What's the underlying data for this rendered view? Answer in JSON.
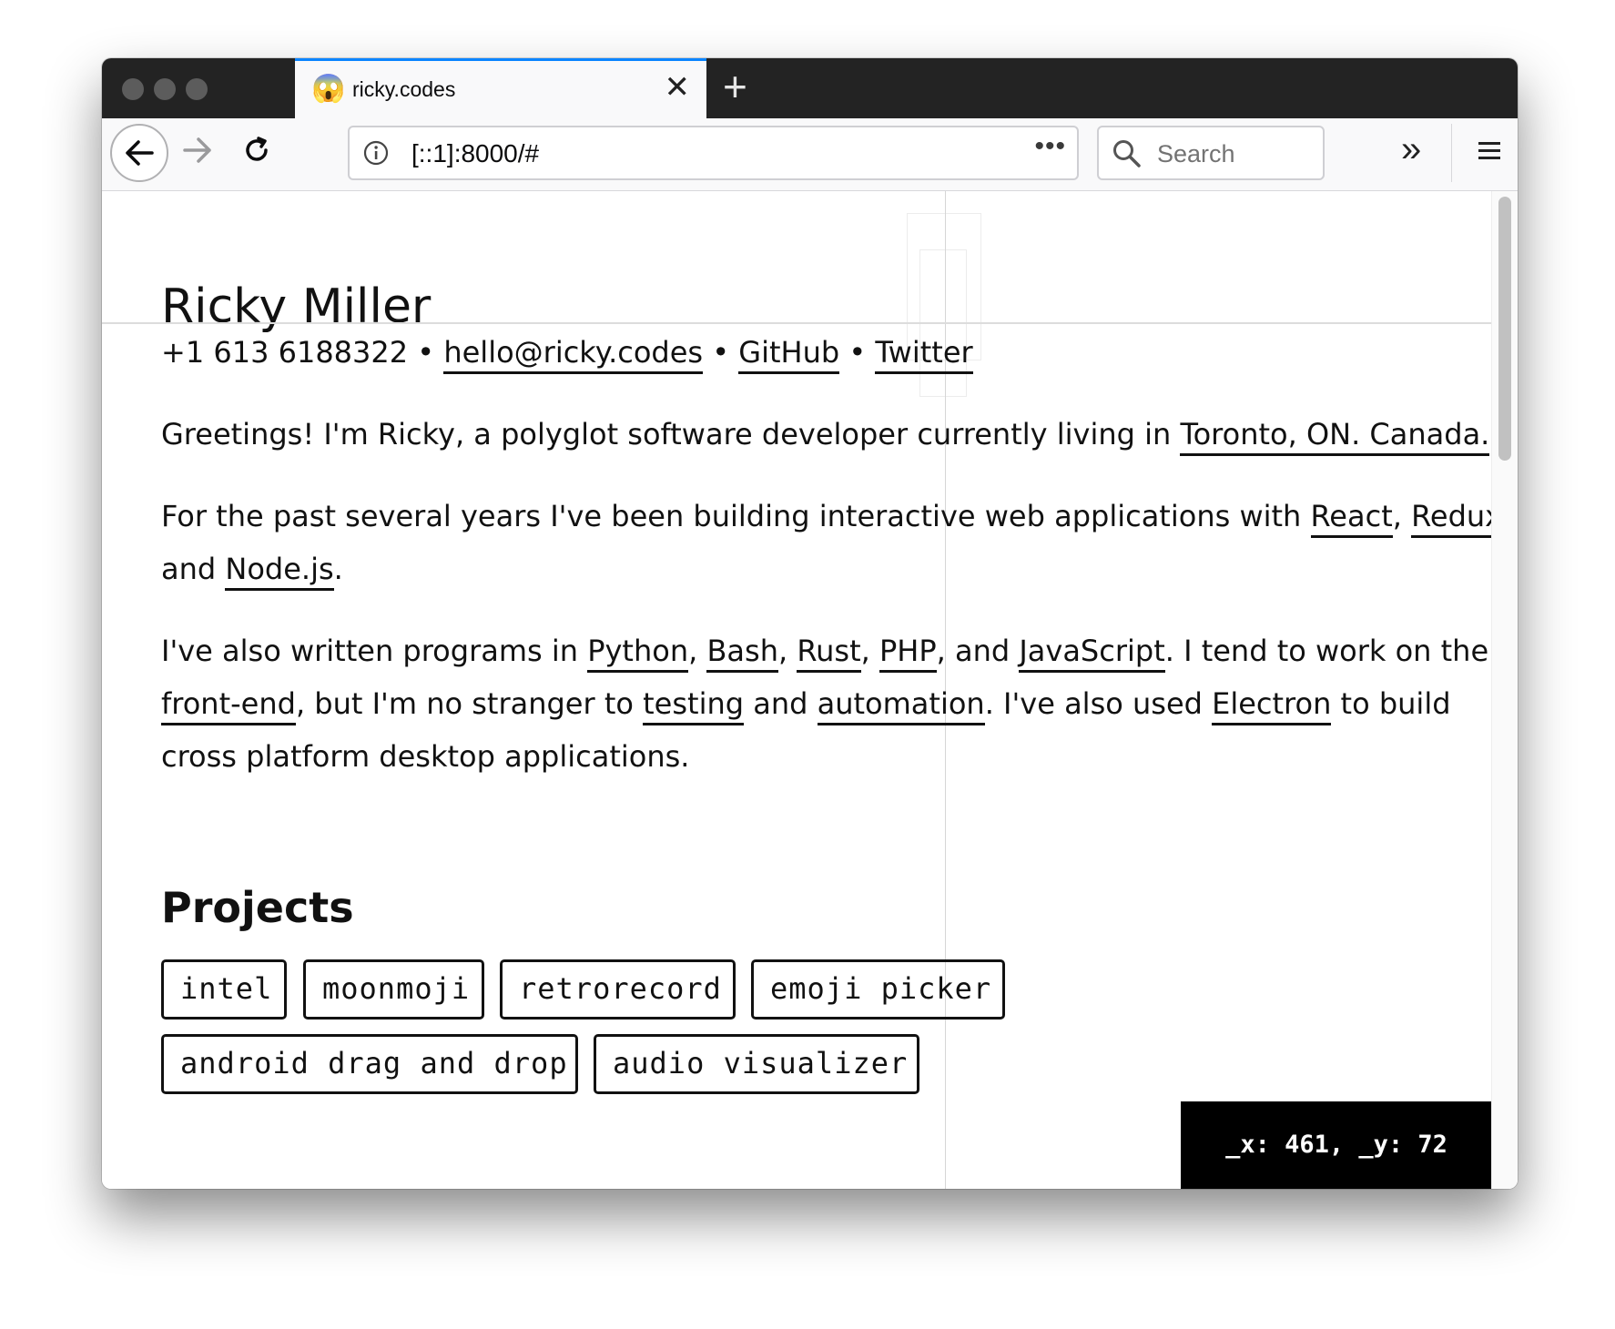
{
  "browser": {
    "tab": {
      "favicon": "😱",
      "title": "ricky.codes",
      "close_glyph": "✕"
    },
    "new_tab_glyph": "+",
    "url": "[::1]:8000/#",
    "url_more": "•••",
    "search_placeholder": "Search",
    "overflow_glyph": "»",
    "icons": [
      "back-arrow-icon",
      "forward-arrow-icon",
      "reload-icon",
      "info-icon",
      "search-icon",
      "menu-icon"
    ]
  },
  "page": {
    "name": "Ricky Miller",
    "contact": {
      "phone": "+1 613 6188322",
      "sep1": " • ",
      "email": "hello@ricky.codes",
      "sep2": " • ",
      "github": "GitHub",
      "sep3": " • ",
      "twitter": "Twitter"
    },
    "p1": {
      "t1": "Greetings! I'm Ricky, a polyglot software developer currently living in ",
      "l1": "Toronto, ON. Canada."
    },
    "p2": {
      "t1": "For the past several years I've been building interactive web applications with ",
      "l1": "React",
      "t2": ", ",
      "l2": "Redux",
      "t3": "and ",
      "l3": "Node.js",
      "t4": "."
    },
    "p3": {
      "t1": "I've also written programs in ",
      "l1": "Python",
      "t2": ", ",
      "l2": "Bash",
      "t3": ", ",
      "l3": "Rust",
      "t4": ", ",
      "l4": "PHP",
      "t5": ", and ",
      "l5": "JavaScript",
      "t6": ". I tend to work on the",
      "l6": "front-end",
      "t7": ", but I'm no stranger to ",
      "l7": "testing",
      "t8": " and ",
      "l8": "automation",
      "t9": ". I've also used ",
      "l9": "Electron",
      "t10": " to build",
      "t11": "cross platform desktop applications."
    },
    "projects_heading": "Projects",
    "projects": [
      "intel",
      "moonmoji",
      "retrorecord",
      "emoji picker",
      "android drag and drop",
      "audio visualizer"
    ],
    "coords": "_x: 461, _y: 72"
  }
}
